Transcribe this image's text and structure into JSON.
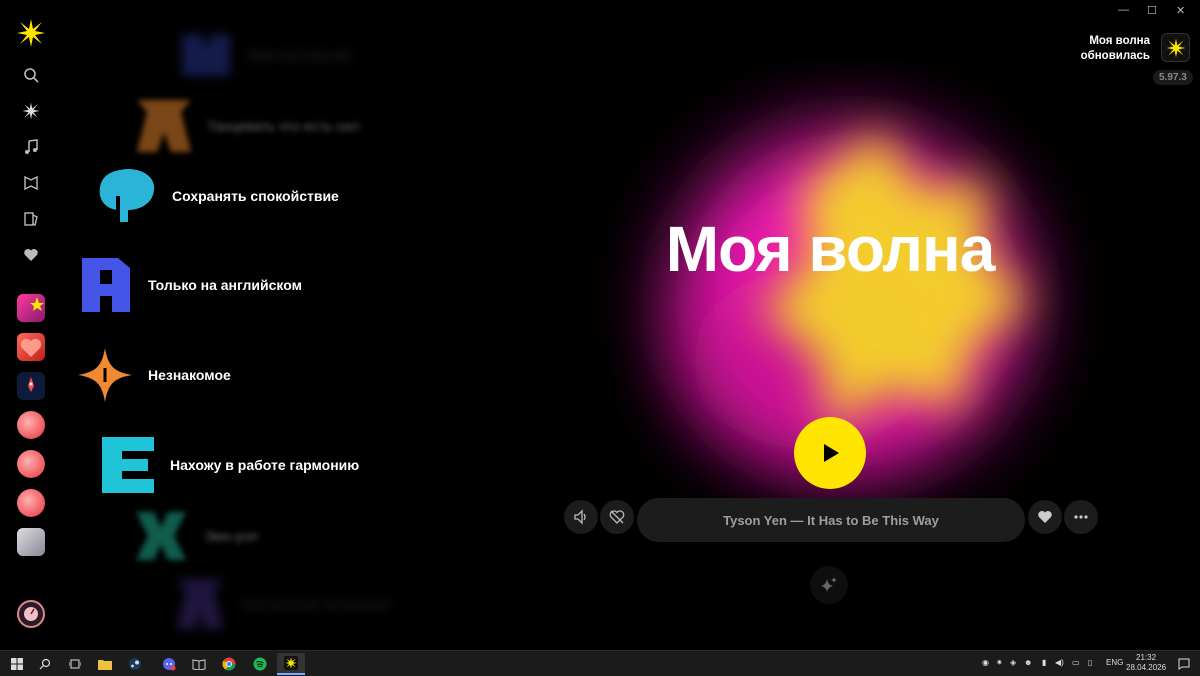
{
  "app": {
    "window_controls": [
      "—",
      "☐",
      "✕"
    ],
    "update_notice": {
      "line1": "Моя волна",
      "line2": "обновилась"
    },
    "version": "5.97.3"
  },
  "sidebar": {
    "nav": [
      "search-icon",
      "wave-icon",
      "music-note-icon",
      "podcast-icon",
      "books-icon",
      "heart-icon"
    ]
  },
  "vibes": [
    {
      "label": "Моя ностальгия",
      "color": "#3b4fd6"
    },
    {
      "label": "Танцевать что есть сил",
      "color": "#e0802a"
    },
    {
      "label": "Сохранять спокойствие",
      "color": "#2ab4d8"
    },
    {
      "label": "Только на английском",
      "color": "#4455e8"
    },
    {
      "label": "Незнакомое",
      "color": "#f08a30"
    },
    {
      "label": "Нахожу в работе гармонию",
      "color": "#20c4d8"
    },
    {
      "label": "Эмо-рэп",
      "color": "#1fa88a"
    },
    {
      "label": "Настроение вечеринки",
      "color": "#5a3fb0"
    }
  ],
  "main": {
    "title": "Моя волна",
    "now_playing": "Tyson Yen — It Has to Be This Way"
  },
  "colors": {
    "accent": "#fee600",
    "blob_pink": "#ff1ec0",
    "blob_yellow": "#f4d626"
  },
  "taskbar": {
    "lang": "ENG",
    "time": "21:32",
    "date": "28.04.2026"
  }
}
